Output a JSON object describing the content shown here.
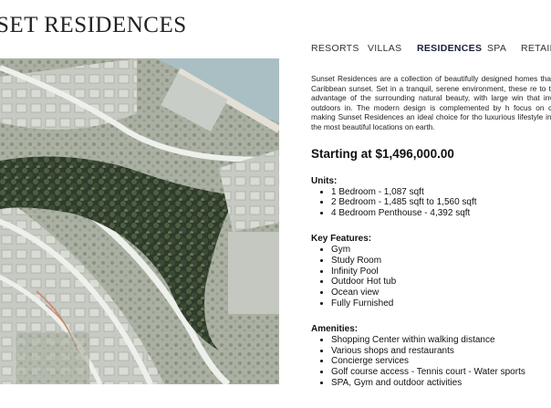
{
  "title": "SET RESIDENCES",
  "nav": {
    "items": [
      {
        "label": "RESORTS"
      },
      {
        "label": "VILLAS"
      },
      {
        "label": "RESIDENCES",
        "active": true
      },
      {
        "label": "SPA"
      },
      {
        "label": "RETAIL"
      }
    ]
  },
  "site_plan": {
    "description": "Aerial site plan of the residences"
  },
  "content": {
    "description": "Sunset Residences are a collection of beautifully designed homes that of the Caribbean sunset. Set in a tranquil, serene environment, these re to take full advantage of the surrounding natural beauty, with large win that invite the outdoors in. The modern design is complemented by h focus on comfort, making Sunset Residences an ideal choice for tho luxurious lifestyle in one of the most beautiful locations on earth.",
    "price": "Starting at $1,496,000.00",
    "units": {
      "title": "Units:",
      "items": [
        "1 Bedroom - 1,087 sqft",
        "2 Bedroom - 1,485 sqft to 1,560 sqft",
        "4 Bedroom Penthouse - 4,392 sqft"
      ]
    },
    "features": {
      "title": "Key Features:",
      "items": [
        "Gym",
        "Study Room",
        "Infinity Pool",
        "Outdoor Hot tub",
        "Ocean view",
        "Fully Furnished"
      ]
    },
    "amenities": {
      "title": "Amenities:",
      "items": [
        "Shopping Center within walking distance",
        "Various shops and restaurants",
        "Concierge services",
        "Golf course access - Tennis court - Water sports",
        "SPA, Gym and outdoor activities"
      ]
    }
  },
  "colors": {
    "nav_active": "#1a1f3a",
    "text": "#111111",
    "map_base": "#b7bcb5"
  }
}
